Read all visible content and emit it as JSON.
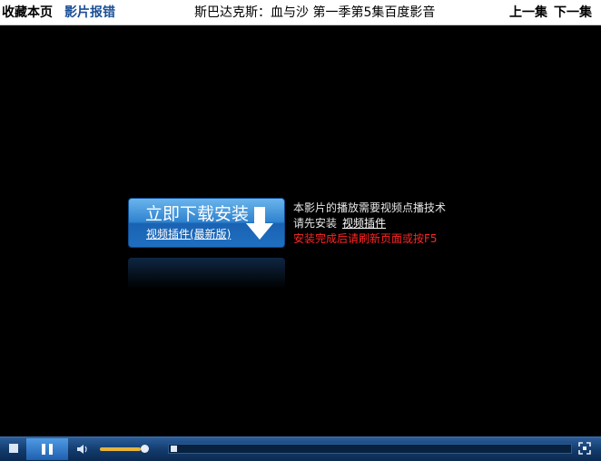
{
  "topbar": {
    "bookmark": "收藏本页",
    "report_error": "影片报错",
    "title": "斯巴达克斯：血与沙 第一季第5集百度影音",
    "prev_episode": "上一集",
    "next_episode": "下一集"
  },
  "install": {
    "button_label": "立即下载安装",
    "button_sub": "视频插件(最新版)",
    "info_line1": "本影片的播放需要视频点播技术",
    "info_line2_prefix": "请先安装",
    "info_line2_link": "视频插件",
    "info_line3": "安装完成后请刷新页面或按F5"
  },
  "player": {
    "volume_fraction": 0.9,
    "progress_fraction": 0.0
  },
  "colors": {
    "report_link": "#1a4e96",
    "warning": "#ff2424",
    "control_bar": "#123a6b",
    "volume_fill": "#e7b43a"
  },
  "icons": [
    "stop-icon",
    "pause-icon",
    "volume-icon",
    "arrow-down-icon",
    "fullscreen-icon"
  ]
}
